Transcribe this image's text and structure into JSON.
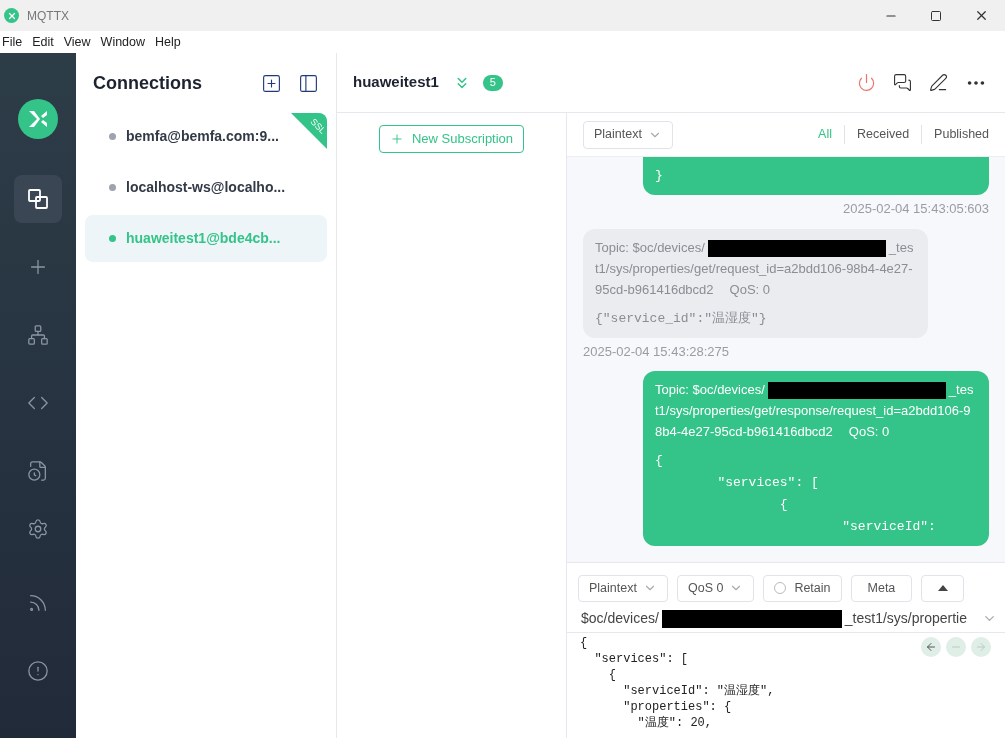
{
  "window": {
    "title": "MQTTX"
  },
  "menu": [
    "File",
    "Edit",
    "View",
    "Window",
    "Help"
  ],
  "nav": [
    {
      "kind": "connections",
      "selected": true
    },
    {
      "kind": "new",
      "selected": false
    },
    {
      "kind": "topology",
      "selected": false
    },
    {
      "kind": "script",
      "selected": false
    },
    {
      "kind": "log",
      "selected": false
    },
    {
      "kind": "settings",
      "selected": false
    },
    {
      "kind": "feed",
      "selected": false
    },
    {
      "kind": "about",
      "selected": false
    }
  ],
  "connections": {
    "title": "Connections",
    "items": [
      {
        "name": "bemfa@bemfa.com:9...",
        "connected": false,
        "ssl": "SSL",
        "selected": false
      },
      {
        "name": "localhost-ws@localho...",
        "connected": false,
        "selected": false
      },
      {
        "name": "huaweitest1@bde4cb...",
        "connected": true,
        "selected": true
      }
    ]
  },
  "header": {
    "name": "huaweitest1",
    "count": "5"
  },
  "subscriptions": {
    "button": "New Subscription"
  },
  "messages": {
    "format": "Plaintext",
    "filters": [
      {
        "label": "All",
        "selected": true
      },
      {
        "label": "Received",
        "selected": false
      },
      {
        "label": "Published",
        "selected": false
      }
    ],
    "items": [
      {
        "kind": "sent",
        "payload": [
          "}"
        ],
        "time": "2025-02-04 15:43:05:603"
      },
      {
        "kind": "received",
        "topic_prefix": "Topic: $oc/devices/",
        "topic_suffix": "_test1/sys/properties/get/request_id=a2bdd106-98b4-4e27-95cd-b961416dbcd2",
        "qos": "QoS: 0",
        "payload": [
          "{\"service_id\":\"温湿度\"}"
        ],
        "time": "2025-02-04 15:43:28:275"
      },
      {
        "kind": "sent",
        "topic_prefix": "Topic: $oc/devices/",
        "topic_suffix": "_test1/sys/properties/get/response/request_id=a2bdd106-98b4-4e27-95cd-b961416dbcd2",
        "qos": "QoS: 0",
        "payload": [
          "{",
          "        \"services\": [",
          "                {",
          "                        \"serviceId\":"
        ]
      }
    ]
  },
  "publish": {
    "format": "Plaintext",
    "qos": "QoS 0",
    "retain": {
      "label": "Retain",
      "checked": false
    },
    "meta": "Meta",
    "topic_prefix": "$oc/devices/",
    "topic_suffix": "_test1/sys/propertie",
    "payload": [
      "{",
      "  \"services\": [",
      "    {",
      "      \"serviceId\": \"温湿度\",",
      "      \"properties\": {",
      "        \"温度\": 20,"
    ]
  }
}
